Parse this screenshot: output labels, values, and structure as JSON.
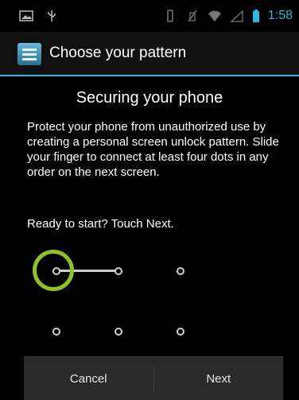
{
  "status_bar": {
    "icons": [
      "gallery-icon",
      "usb-icon",
      "vibrate-icon",
      "no-sim-icon",
      "wifi-icon",
      "signal-icon",
      "battery-icon"
    ],
    "time": "1:58",
    "accent": "#33b5e5"
  },
  "title_bar": {
    "title": "Choose your pattern"
  },
  "content": {
    "heading": "Securing your phone",
    "description": "Protect your phone from unauthorized use by creating a personal screen unlock pattern. Slide your finger to connect at least four dots in any order on the next screen.",
    "ready": "Ready to start? Touch Next."
  },
  "pattern": {
    "rows": 3,
    "cols": 3,
    "highlight_color": "#8fc22a"
  },
  "buttons": {
    "cancel": "Cancel",
    "next": "Next"
  }
}
